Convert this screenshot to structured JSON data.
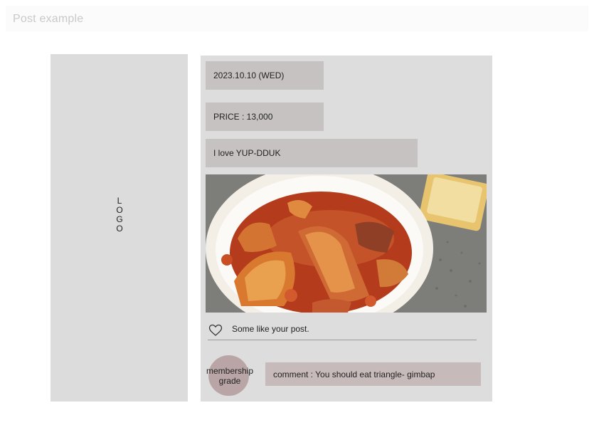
{
  "header": {
    "title": "Post example"
  },
  "logo": {
    "text": "LOGO"
  },
  "post": {
    "date": "2023.10.10 (WED)",
    "price": "PRICE : 13,000",
    "caption": "I love YUP-DDUK",
    "photo": {
      "subject": "tteokbokki-bowl-photo"
    },
    "like": {
      "icon": "heart-icon",
      "text": "Some like your post."
    },
    "membership": {
      "text": "membership grade"
    },
    "comment": {
      "text": "comment : You should eat triangle- gimbap"
    }
  },
  "colors": {
    "panel": "#dedddd",
    "info_box": "#c7c2c2",
    "grade_circle": "#b9a5a5",
    "comment_box": "#c7baba"
  }
}
